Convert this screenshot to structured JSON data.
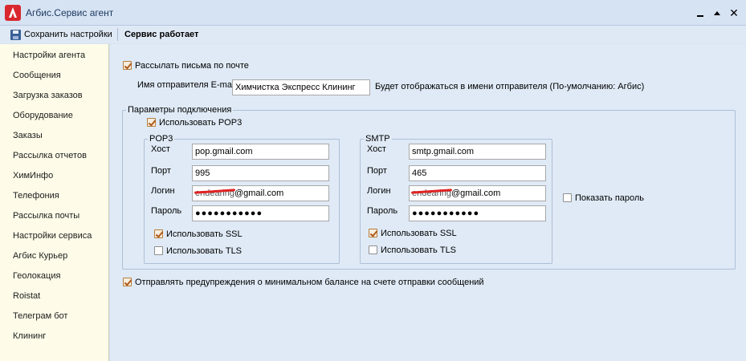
{
  "window": {
    "title": "Агбис.Сервис агент",
    "controls": [
      "minimize",
      "maximize",
      "close"
    ]
  },
  "toolbar": {
    "save_label": "Сохранить настройки",
    "save_icon": "floppy-disk-icon",
    "status": "Сервис работает"
  },
  "sidebar": {
    "items": [
      {
        "label": "Настройки агента"
      },
      {
        "label": "Сообщения"
      },
      {
        "label": "Загрузка заказов"
      },
      {
        "label": "Оборудование"
      },
      {
        "label": "Заказы"
      },
      {
        "label": "Рассылка отчетов"
      },
      {
        "label": "ХимИнфо"
      },
      {
        "label": "Телефония"
      },
      {
        "label": "Рассылка почты"
      },
      {
        "label": "Настройки сервиса"
      },
      {
        "label": "Агбис Курьер"
      },
      {
        "label": "Геолокация"
      },
      {
        "label": "Roistat"
      },
      {
        "label": "Телеграм бот"
      },
      {
        "label": "Клининг"
      }
    ]
  },
  "mail": {
    "send_by_mail": {
      "label": "Рассылать письма по почте",
      "checked": true
    },
    "sender_name": {
      "label": "Имя отправителя E-mail",
      "value": "Химчистка Экспресс Клининг",
      "hint": "Будет отображаться в имени отправителя (По-умолчанию: Агбис)"
    },
    "connection": {
      "group_title": "Параметры подключения",
      "use_pop3": {
        "label": "Использовать POP3",
        "checked": true
      },
      "pop3": {
        "group_title": "POP3",
        "host_label": "Хост",
        "host_value": "pop.gmail.com",
        "port_label": "Порт",
        "port_value": "995",
        "login_label": "Логин",
        "login_hidden": "endearing",
        "login_domain": "@gmail.com",
        "password_label": "Пароль",
        "password_mask": "●●●●●●●●●●●",
        "use_ssl": {
          "label": "Использовать SSL",
          "checked": true
        },
        "use_tls": {
          "label": "Использовать TLS",
          "checked": false
        }
      },
      "smtp": {
        "group_title": "SMTP",
        "host_label": "Хост",
        "host_value": "smtp.gmail.com",
        "port_label": "Порт",
        "port_value": "465",
        "login_label": "Логин",
        "login_hidden": "endearing",
        "login_domain": "@gmail.com",
        "password_label": "Пароль",
        "password_mask": "●●●●●●●●●●●",
        "use_ssl": {
          "label": "Использовать SSL",
          "checked": true
        },
        "use_tls": {
          "label": "Использовать TLS",
          "checked": false
        }
      },
      "show_password": {
        "label": "Показать пароль",
        "checked": false
      }
    },
    "min_balance_warning": {
      "label": "Отправлять предупреждения о минимальном балансе на счете отправки сообщений",
      "checked": true
    }
  },
  "colors": {
    "frame": "#d6e3f3",
    "sidebar_bg": "#fefce8",
    "content_bg": "#dfeaf6",
    "logo_red": "#d9272e",
    "check_mark": "#b05a1a"
  }
}
